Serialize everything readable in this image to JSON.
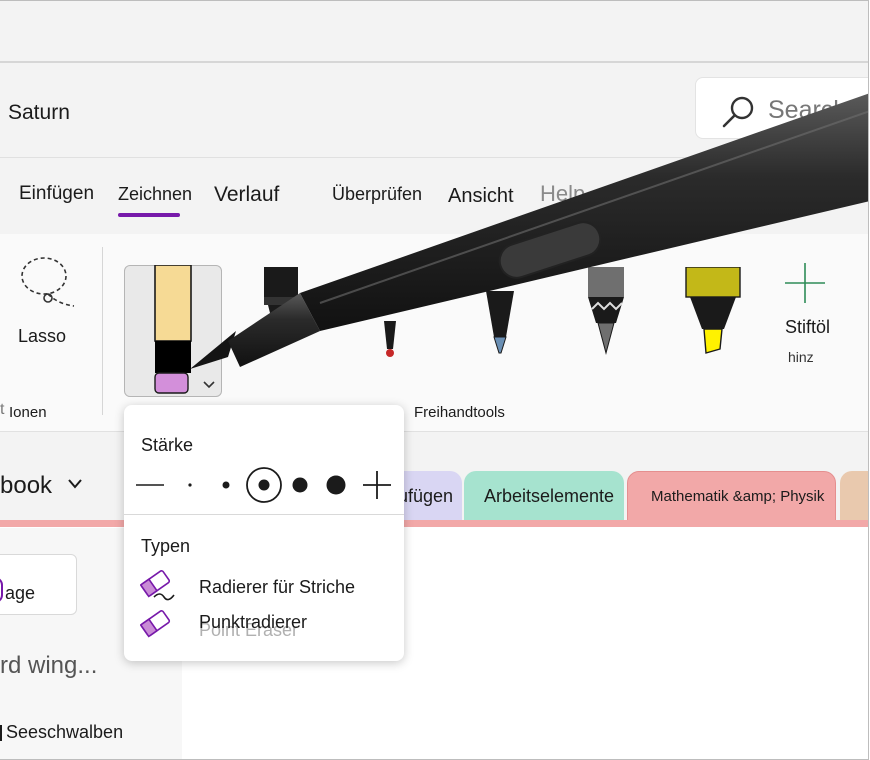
{
  "app": {
    "doc_title": "Saturn",
    "search_placeholder": "Search"
  },
  "ribbon_tabs": [
    {
      "label": "Einfügen"
    },
    {
      "label": "Zeichnen",
      "active": true
    },
    {
      "label": "Verlauf"
    },
    {
      "label": "Überprüfen"
    },
    {
      "label": "Ansicht"
    },
    {
      "label": "Help"
    }
  ],
  "ribbon": {
    "lasso_label": "Lasso",
    "group_selection_label": "Ionen",
    "group_selection_prefix": "t",
    "group_tools_label": "Freihandtools",
    "add_pen_label": "Stiftöl",
    "add_pen_sublabel": "hinz",
    "pens": [
      {
        "name": "eraser",
        "colors": [
          "#f6da95",
          "#000000",
          "#d38fda"
        ]
      },
      {
        "name": "marker",
        "color": "#1a1a1a"
      },
      {
        "name": "pen",
        "color": "#c62828"
      },
      {
        "name": "pen",
        "color": "#6a8fb4"
      },
      {
        "name": "pencil",
        "color": "#6f6f6f"
      },
      {
        "name": "highlighter",
        "color": "#c3b818"
      }
    ],
    "accent_color": "#7719aa"
  },
  "notebook": {
    "name": "book",
    "sections": [
      {
        "label": "ufügen",
        "color": "#d9d6f3"
      },
      {
        "label": "Arbeitselemente",
        "color": "#a6e3cf"
      },
      {
        "label": "Mathematik &amp; Physik",
        "color": "#f2a8a8"
      },
      {
        "label": "",
        "color": "#e9c9ae"
      }
    ]
  },
  "left_pane": {
    "add_page_label": "age",
    "item1": "rd wing...",
    "item2": "Seeschwalben"
  },
  "eraser_flyout": {
    "strength_heading": "Stärke",
    "thickness_options": [
      "thinnest",
      "thin",
      "small",
      "medium",
      "large",
      "largest"
    ],
    "selected_thickness": "medium",
    "types_heading": "Typen",
    "types": [
      {
        "label": "Radierer für Striche"
      },
      {
        "label": "Punktradierer"
      }
    ],
    "ghost_text": "Point Eraser"
  }
}
